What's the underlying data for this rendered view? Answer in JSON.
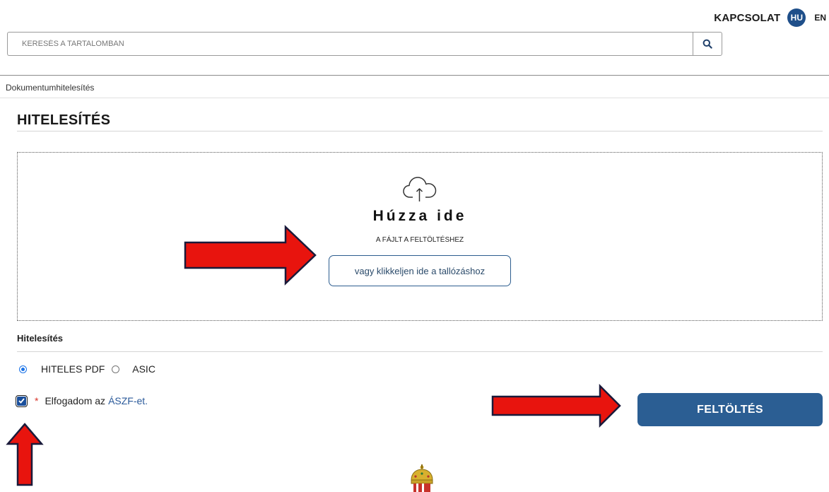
{
  "header": {
    "contact_label": "KAPCSOLAT",
    "lang_current": "HU",
    "lang_other": "EN"
  },
  "search": {
    "placeholder": "KERESÉS A TARTALOMBAN",
    "icon": "search-icon"
  },
  "breadcrumb": "Dokumentumhitelesítés",
  "page_title": "HITELESÍTÉS",
  "dropzone": {
    "icon": "cloud-upload-icon",
    "title": "Húzza ide",
    "subtitle": "A FÁJLT A FELTÖLTÉSHEZ",
    "browse_label": "vagy klikkeljen ide a tallózáshoz"
  },
  "format": {
    "section_label": "Hitelesítés",
    "options": [
      {
        "label": "HITELES PDF",
        "selected": true
      },
      {
        "label": "ASIC",
        "selected": false
      }
    ]
  },
  "terms": {
    "checked": true,
    "required_mark": "*",
    "text": "Elfogadom az",
    "link_text": "ÁSZF-et."
  },
  "upload_label": "FELTÖLTÉS",
  "colors": {
    "primary": "#2b5e93",
    "arrow": "#e8140e",
    "required": "#d9362b"
  }
}
